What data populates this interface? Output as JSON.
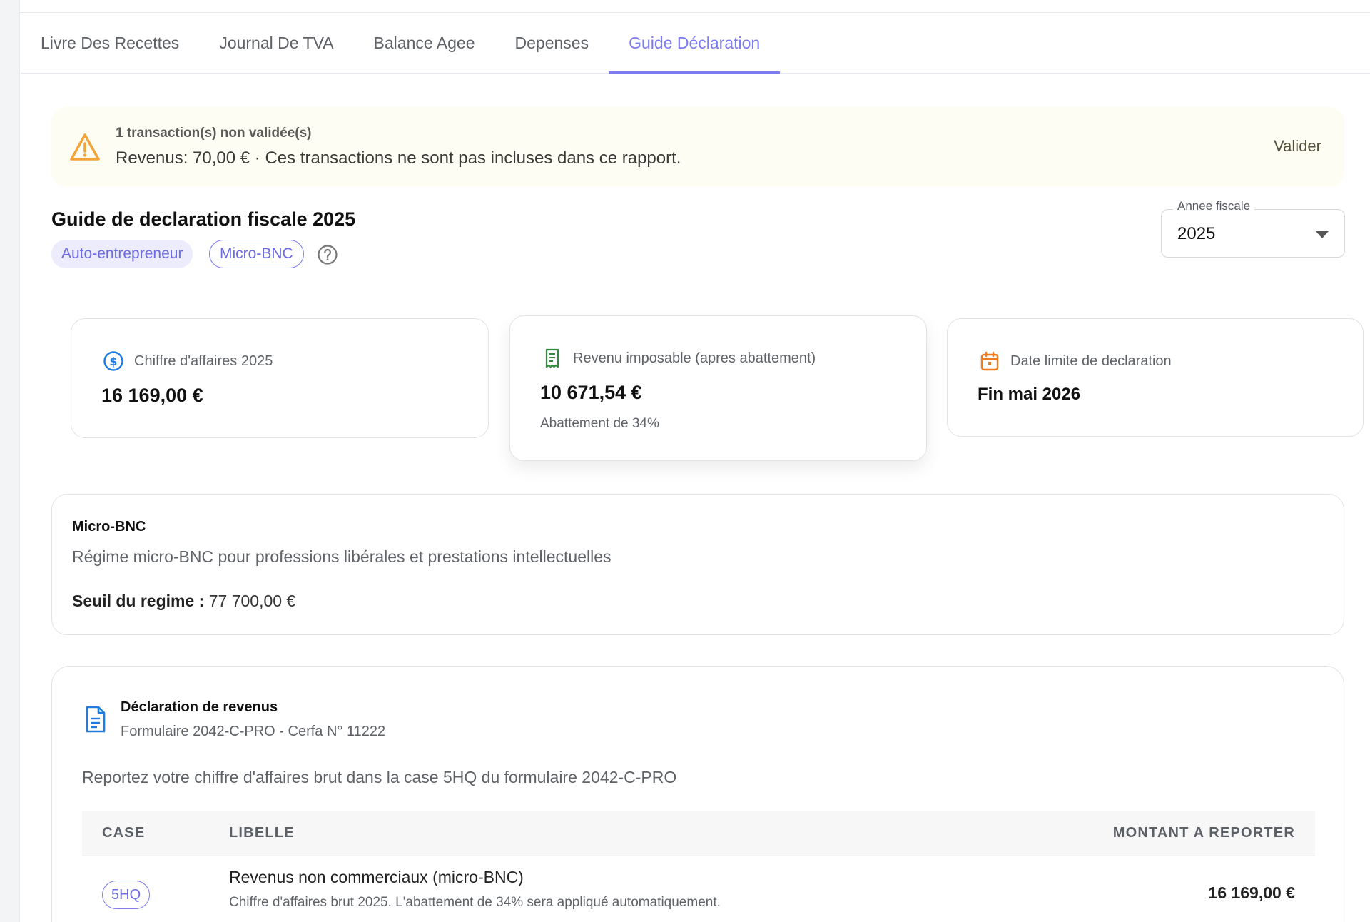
{
  "tabs": [
    {
      "label": "Livre Des Recettes"
    },
    {
      "label": "Journal De TVA"
    },
    {
      "label": "Balance Agee"
    },
    {
      "label": "Depenses"
    },
    {
      "label": "Guide Déclaration",
      "active": true
    }
  ],
  "alert": {
    "title": "1 transaction(s) non validée(s)",
    "message": "Revenus: 70,00 € · Ces transactions ne sont pas incluses dans ce rapport.",
    "action": "Valider",
    "icon": "warning-icon",
    "color": "#f2a33a"
  },
  "header": {
    "title": "Guide de declaration fiscale 2025",
    "chips": [
      "Auto-entrepreneur",
      "Micro-BNC"
    ],
    "help_icon": "help-circle-icon"
  },
  "year_select": {
    "label": "Annee fiscale",
    "value": "2025"
  },
  "stats": [
    {
      "label": "Chiffre d'affaires 2025",
      "value": "16 169,00 €",
      "icon": "dollar-icon",
      "color": "#1e7be0"
    },
    {
      "label": "Revenu imposable (apres abattement)",
      "value": "10 671,54 €",
      "sub": "Abattement de 34%",
      "icon": "receipt-icon",
      "color": "#2e8b3c"
    },
    {
      "label": "Date limite de declaration",
      "value": "Fin mai 2026",
      "icon": "calendar-icon",
      "color": "#f07a1e"
    }
  ],
  "regime": {
    "title": "Micro-BNC",
    "description": "Régime micro-BNC pour professions libérales et prestations intellectuelles",
    "seuil_label": "Seuil du regime :",
    "seuil_value": "77 700,00 €"
  },
  "declaration": {
    "title": "Déclaration de revenus",
    "subtitle": "Formulaire 2042-C-PRO - Cerfa N° 11222",
    "info": "Reportez votre chiffre d'affaires brut dans la case 5HQ du formulaire 2042-C-PRO",
    "columns": [
      "CASE",
      "LIBELLE",
      "MONTANT A REPORTER"
    ],
    "rows": [
      {
        "case": "5HQ",
        "libelle": "Revenus non commerciaux (micro-BNC)",
        "note": "Chiffre d'affaires brut 2025. L'abattement de 34% sera appliqué automatiquement.",
        "montant": "16 169,00 €"
      }
    ]
  },
  "colors": {
    "accent": "#7c7cf0",
    "alert_bg": "#fefdf3"
  }
}
